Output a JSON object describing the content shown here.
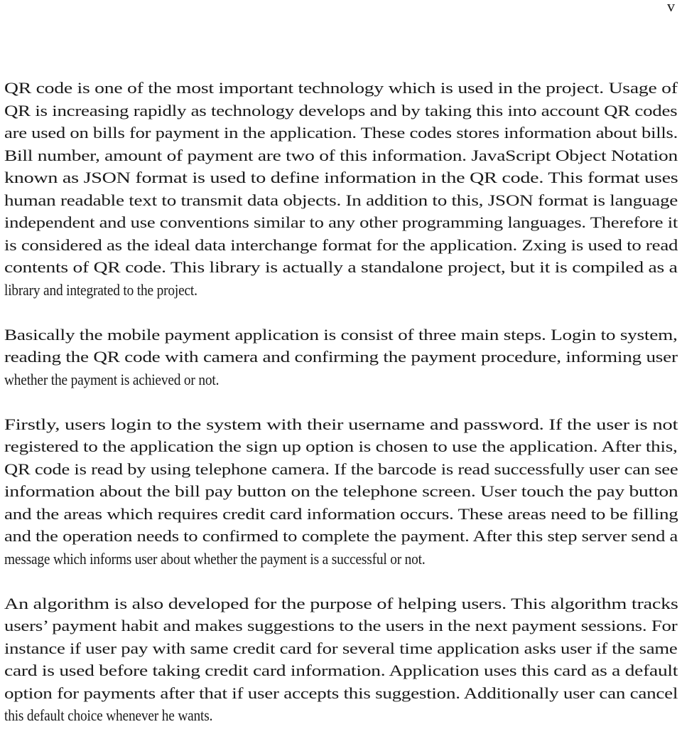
{
  "page": {
    "page_number": "v"
  },
  "document": {
    "paragraphs": [
      {
        "lines": [
          "QR code is one of the most important technology which is used in the project. Usage of",
          "QR is increasing rapidly as technology develops and by taking this into account QR codes",
          "are used on bills for payment in the application. These codes stores information about bills.",
          "Bill number, amount of payment are two of this information. JavaScript Object Notation",
          "known as JSON format is used to define information in the QR code.  This format uses",
          "human readable text to transmit data objects. In addition to this, JSON format is language",
          "independent and use conventions similar to any other programming languages. Therefore it",
          "is considered as the ideal data interchange format for the application. Zxing is used to read",
          "contents of QR code. This library is actually a standalone project, but it is compiled as a",
          "library and integrated to the project."
        ]
      },
      {
        "lines": [
          "Basically the mobile payment application is consist of three main steps. Login to system,",
          "reading the QR code with camera and confirming the payment procedure, informing user",
          "whether the payment is achieved or not."
        ]
      },
      {
        "lines": [
          "Firstly, users login to the system with their username and password. If the user is not",
          "registered to the application the sign up option is chosen to use the application. After this,",
          "QR code is read by using telephone camera. If the barcode is read successfully user can see",
          "information about the bill pay button on the telephone screen. User touch the pay button",
          "and the areas which requires credit card information occurs. These areas need to be filling",
          "and the operation needs to confirmed to complete the payment. After this step server send a",
          "message which informs user about whether the payment is a successful or not."
        ]
      },
      {
        "lines": [
          "An algorithm is also developed for the purpose of helping users. This algorithm tracks",
          "users’ payment habit and makes suggestions to the users in the next payment sessions. For",
          "instance if user pay with same credit card for several time application asks user if the same",
          "card is used before taking credit card information. Application uses this card as a default",
          "option for payments after that if user accepts this suggestion. Additionally user can cancel",
          "this default choice whenever he wants."
        ]
      }
    ]
  }
}
